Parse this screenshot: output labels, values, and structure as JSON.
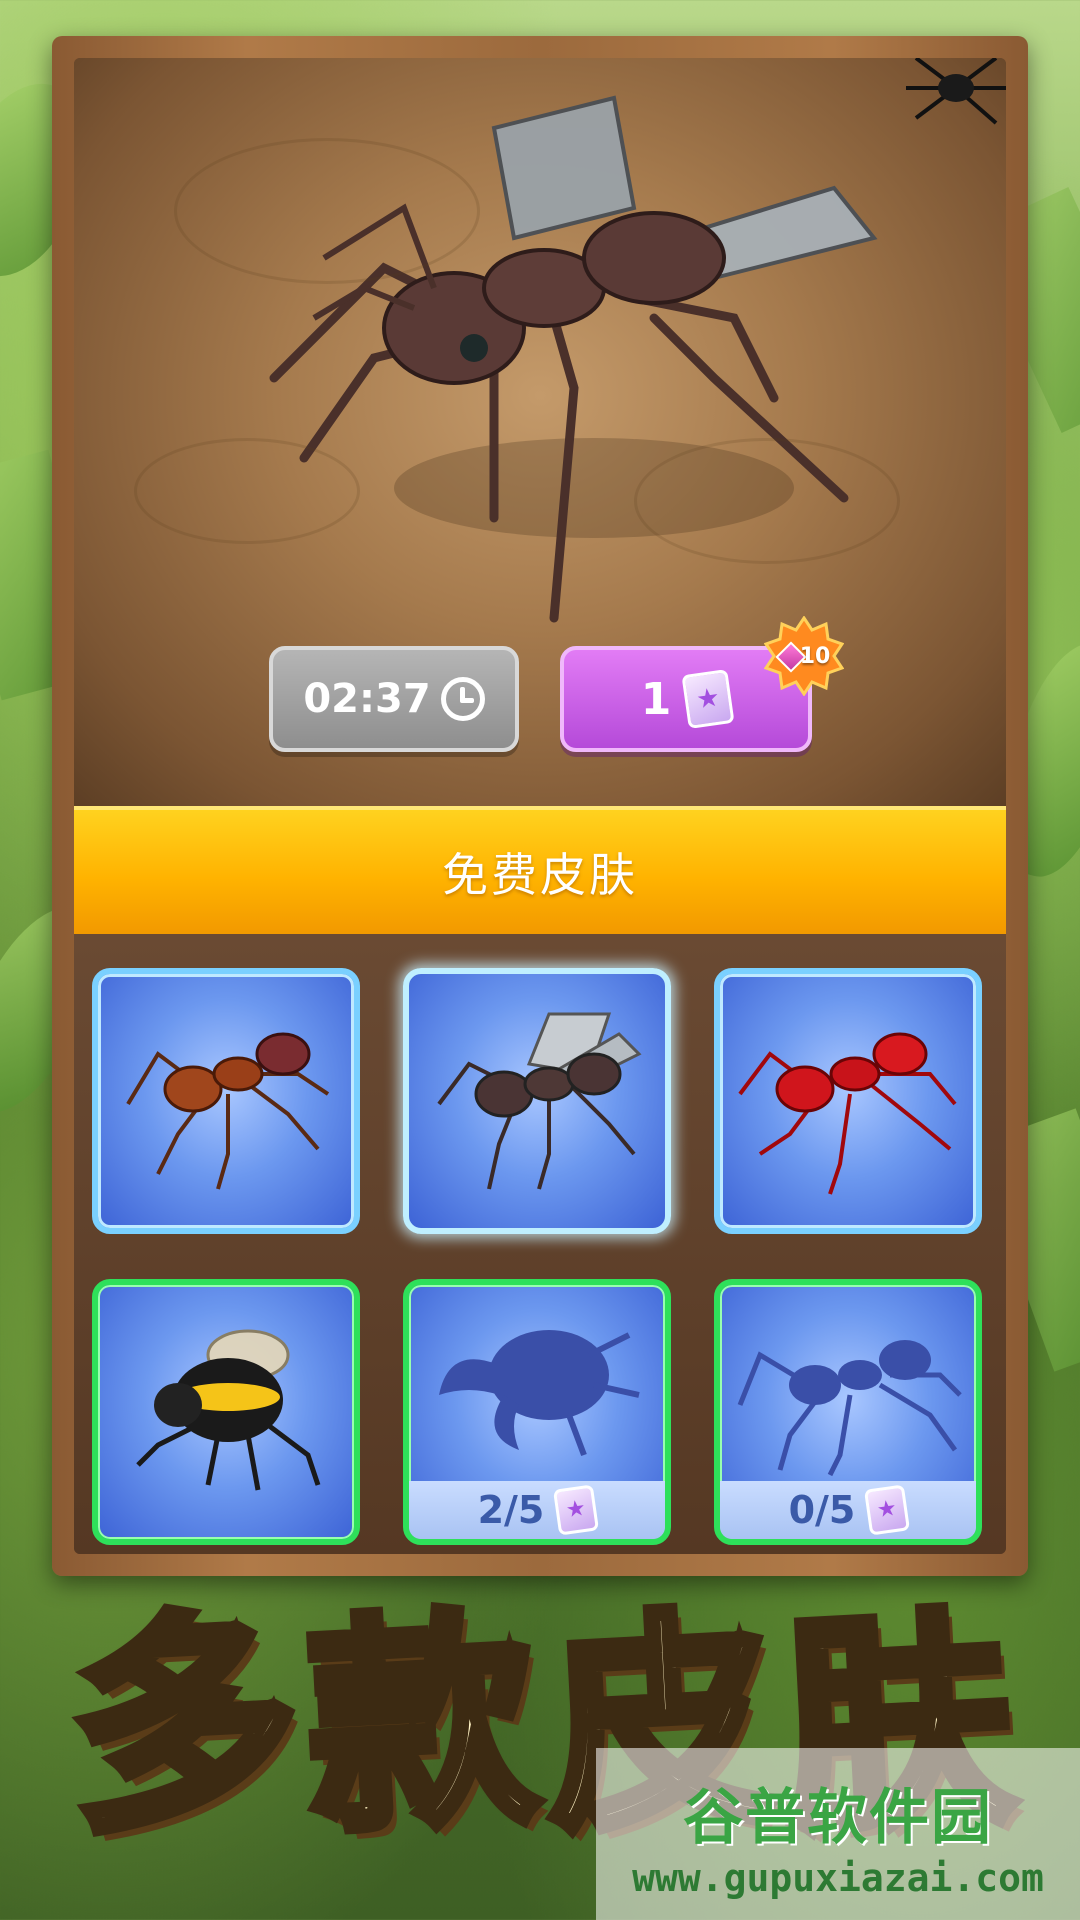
{
  "hud": {
    "timer": "02:37",
    "price": "1",
    "gem_bonus": "10"
  },
  "banner": {
    "label": "免费皮肤"
  },
  "skins": [
    {
      "name": "fire-ant",
      "state": "owned"
    },
    {
      "name": "winged-ant",
      "state": "selected"
    },
    {
      "name": "red-ant",
      "state": "owned"
    },
    {
      "name": "bumblebee",
      "state": "owned-green"
    },
    {
      "name": "stag-beetle",
      "state": "locked",
      "progress": "2/5"
    },
    {
      "name": "spider-ant",
      "state": "locked",
      "progress": "0/5"
    }
  ],
  "title": {
    "chars": [
      "多",
      "款",
      "皮",
      "肤"
    ]
  },
  "watermark": {
    "main": "谷普软件园",
    "sub": "www.gupuxiazai.com"
  },
  "colors": {
    "banner": "#ffb300",
    "buy_button": "#c85ee6",
    "timer_button": "#9e9e9e",
    "card_bg": "#6c98ef",
    "locked_border": "#2ee05a",
    "owned_border": "#7ad0ff"
  }
}
